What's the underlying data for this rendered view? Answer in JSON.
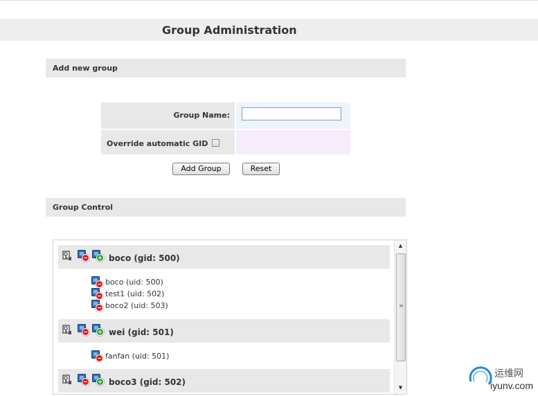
{
  "page": {
    "title": "Group Administration"
  },
  "add_group": {
    "section_title": "Add new group",
    "group_name_label": "Group Name:",
    "group_name_value": "",
    "override_gid_label": "Override automatic GID",
    "override_gid_checked": false,
    "add_button": "Add Group",
    "reset_button": "Reset"
  },
  "group_control": {
    "section_title": "Group Control",
    "groups": [
      {
        "label": "boco (gid: 500)",
        "users": [
          "boco (uid: 500)",
          "test1 (uid: 502)",
          "boco2 (uid: 503)"
        ]
      },
      {
        "label": "wei (gid: 501)",
        "users": [
          "fanfan (uid: 501)"
        ]
      },
      {
        "label": "boco3 (gid: 502)",
        "users": []
      }
    ]
  },
  "icons": {
    "group_actions": [
      "edit-group-icon",
      "remove-group-icon",
      "add-user-to-group-icon"
    ],
    "user_action": "remove-user-from-group-icon"
  },
  "colors": {
    "title_bar": "#eeeeee",
    "section_bar": "#e8e8e8",
    "input_cell_name": "#eef4fb",
    "input_cell_gid": "#f6ecfc",
    "remove_badge": "#d62020",
    "add_badge": "#2aa52a"
  },
  "watermark": {
    "cn": "运维网",
    "en": "iyunv.com"
  }
}
